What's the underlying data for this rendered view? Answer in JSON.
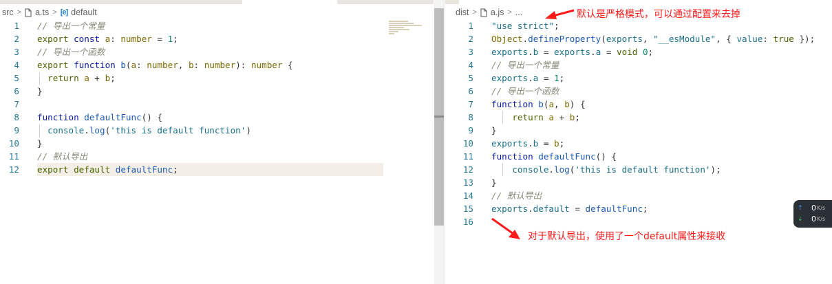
{
  "left": {
    "breadcrumb": {
      "folder": "src",
      "file": "a.ts",
      "symbol": "default"
    },
    "lines": [
      {
        "n": "1",
        "tokens": [
          {
            "t": "// 导出一个常量",
            "c": "c"
          }
        ]
      },
      {
        "n": "2",
        "tokens": [
          {
            "t": "export ",
            "c": "kw"
          },
          {
            "t": "const ",
            "c": "kw2"
          },
          {
            "t": "a",
            "c": "id"
          },
          {
            "t": ": ",
            "c": "pl"
          },
          {
            "t": "number",
            "c": "ty"
          },
          {
            "t": " = ",
            "c": "pl"
          },
          {
            "t": "1",
            "c": "num"
          },
          {
            "t": ";",
            "c": "pl"
          }
        ]
      },
      {
        "n": "3",
        "tokens": [
          {
            "t": "// 导出一个函数",
            "c": "c"
          }
        ]
      },
      {
        "n": "4",
        "tokens": [
          {
            "t": "export ",
            "c": "kw"
          },
          {
            "t": "function ",
            "c": "kw2"
          },
          {
            "t": "b",
            "c": "fn"
          },
          {
            "t": "(",
            "c": "pl"
          },
          {
            "t": "a",
            "c": "id"
          },
          {
            "t": ": ",
            "c": "pl"
          },
          {
            "t": "number",
            "c": "ty"
          },
          {
            "t": ", ",
            "c": "pl"
          },
          {
            "t": "b",
            "c": "id"
          },
          {
            "t": ": ",
            "c": "pl"
          },
          {
            "t": "number",
            "c": "ty"
          },
          {
            "t": "): ",
            "c": "pl"
          },
          {
            "t": "number",
            "c": "ty"
          },
          {
            "t": " {",
            "c": "pl"
          }
        ]
      },
      {
        "n": "5",
        "tokens": [
          {
            "t": "  return ",
            "c": "kw"
          },
          {
            "t": "a",
            "c": "id"
          },
          {
            "t": " + ",
            "c": "pl"
          },
          {
            "t": "b",
            "c": "id"
          },
          {
            "t": ";",
            "c": "pl"
          }
        ]
      },
      {
        "n": "6",
        "tokens": [
          {
            "t": "}",
            "c": "pl"
          }
        ]
      },
      {
        "n": "7",
        "tokens": []
      },
      {
        "n": "8",
        "tokens": [
          {
            "t": "function ",
            "c": "kw2"
          },
          {
            "t": "defaultFunc",
            "c": "fn"
          },
          {
            "t": "() {",
            "c": "pl"
          }
        ]
      },
      {
        "n": "9",
        "tokens": [
          {
            "t": "  console",
            "c": "str2"
          },
          {
            "t": ".",
            "c": "pl"
          },
          {
            "t": "log",
            "c": "fn"
          },
          {
            "t": "(",
            "c": "pl"
          },
          {
            "t": "'this is default function'",
            "c": "str2"
          },
          {
            "t": ")",
            "c": "pl"
          }
        ]
      },
      {
        "n": "10",
        "tokens": [
          {
            "t": "}",
            "c": "pl"
          }
        ]
      },
      {
        "n": "11",
        "tokens": [
          {
            "t": "// 默认导出",
            "c": "c"
          }
        ]
      },
      {
        "n": "12",
        "tokens": [
          {
            "t": "export ",
            "c": "kw"
          },
          {
            "t": "default ",
            "c": "kw"
          },
          {
            "t": "defaultFunc",
            "c": "fn"
          },
          {
            "t": ";",
            "c": "pl"
          }
        ]
      }
    ]
  },
  "right": {
    "breadcrumb": {
      "folder": "dist",
      "file": "a.js",
      "more": "..."
    },
    "lines": [
      {
        "n": "1",
        "tokens": [
          {
            "t": "\"use strict\"",
            "c": "str2"
          },
          {
            "t": ";",
            "c": "pl"
          }
        ]
      },
      {
        "n": "2",
        "tokens": [
          {
            "t": "Object",
            "c": "id"
          },
          {
            "t": ".",
            "c": "pl"
          },
          {
            "t": "defineProperty",
            "c": "fn"
          },
          {
            "t": "(",
            "c": "pl"
          },
          {
            "t": "exports",
            "c": "str2"
          },
          {
            "t": ", ",
            "c": "pl"
          },
          {
            "t": "\"__esModule\"",
            "c": "str2"
          },
          {
            "t": ", { ",
            "c": "pl"
          },
          {
            "t": "value",
            "c": "str2"
          },
          {
            "t": ": ",
            "c": "pl"
          },
          {
            "t": "true",
            "c": "kw"
          },
          {
            "t": " });",
            "c": "pl"
          }
        ]
      },
      {
        "n": "3",
        "tokens": [
          {
            "t": "exports",
            "c": "str2"
          },
          {
            "t": ".",
            "c": "pl"
          },
          {
            "t": "b",
            "c": "str2"
          },
          {
            "t": " = ",
            "c": "pl"
          },
          {
            "t": "exports",
            "c": "str2"
          },
          {
            "t": ".",
            "c": "pl"
          },
          {
            "t": "a",
            "c": "str2"
          },
          {
            "t": " = ",
            "c": "pl"
          },
          {
            "t": "void ",
            "c": "kw"
          },
          {
            "t": "0",
            "c": "num"
          },
          {
            "t": ";",
            "c": "pl"
          }
        ]
      },
      {
        "n": "4",
        "tokens": [
          {
            "t": "// 导出一个常量",
            "c": "c"
          }
        ]
      },
      {
        "n": "5",
        "tokens": [
          {
            "t": "exports",
            "c": "str2"
          },
          {
            "t": ".",
            "c": "pl"
          },
          {
            "t": "a",
            "c": "str2"
          },
          {
            "t": " = ",
            "c": "pl"
          },
          {
            "t": "1",
            "c": "num"
          },
          {
            "t": ";",
            "c": "pl"
          }
        ]
      },
      {
        "n": "6",
        "tokens": [
          {
            "t": "// 导出一个函数",
            "c": "c"
          }
        ]
      },
      {
        "n": "7",
        "tokens": [
          {
            "t": "function ",
            "c": "kw2"
          },
          {
            "t": "b",
            "c": "fn"
          },
          {
            "t": "(",
            "c": "pl"
          },
          {
            "t": "a",
            "c": "id"
          },
          {
            "t": ", ",
            "c": "pl"
          },
          {
            "t": "b",
            "c": "id"
          },
          {
            "t": ") {",
            "c": "pl"
          }
        ]
      },
      {
        "n": "8",
        "tokens": [
          {
            "t": "    return ",
            "c": "kw"
          },
          {
            "t": "a",
            "c": "id"
          },
          {
            "t": " + ",
            "c": "pl"
          },
          {
            "t": "b",
            "c": "id"
          },
          {
            "t": ";",
            "c": "pl"
          }
        ]
      },
      {
        "n": "9",
        "tokens": [
          {
            "t": "}",
            "c": "pl"
          }
        ]
      },
      {
        "n": "10",
        "tokens": [
          {
            "t": "exports",
            "c": "str2"
          },
          {
            "t": ".",
            "c": "pl"
          },
          {
            "t": "b",
            "c": "str2"
          },
          {
            "t": " = ",
            "c": "pl"
          },
          {
            "t": "b",
            "c": "id"
          },
          {
            "t": ";",
            "c": "pl"
          }
        ]
      },
      {
        "n": "11",
        "tokens": [
          {
            "t": "function ",
            "c": "kw2"
          },
          {
            "t": "defaultFunc",
            "c": "fn"
          },
          {
            "t": "() {",
            "c": "pl"
          }
        ]
      },
      {
        "n": "12",
        "tokens": [
          {
            "t": "    console",
            "c": "str2"
          },
          {
            "t": ".",
            "c": "pl"
          },
          {
            "t": "log",
            "c": "fn"
          },
          {
            "t": "(",
            "c": "pl"
          },
          {
            "t": "'this is default function'",
            "c": "str2"
          },
          {
            "t": ");",
            "c": "pl"
          }
        ]
      },
      {
        "n": "13",
        "tokens": [
          {
            "t": "}",
            "c": "pl"
          }
        ]
      },
      {
        "n": "14",
        "tokens": [
          {
            "t": "// 默认导出",
            "c": "c"
          }
        ]
      },
      {
        "n": "15",
        "tokens": [
          {
            "t": "exports",
            "c": "str2"
          },
          {
            "t": ".",
            "c": "pl"
          },
          {
            "t": "default",
            "c": "str2"
          },
          {
            "t": " = ",
            "c": "pl"
          },
          {
            "t": "defaultFunc",
            "c": "fn"
          },
          {
            "t": ";",
            "c": "pl"
          }
        ]
      },
      {
        "n": "16",
        "tokens": []
      }
    ]
  },
  "annotations": {
    "top": "默认是严格模式，可以通过配置来去掉",
    "bottom": "对于默认导出，使用了一个default属性来接收"
  },
  "net_widget": {
    "up_value": "0",
    "up_unit": "K/s",
    "down_value": "0",
    "down_unit": "K/s"
  },
  "colors": {
    "annotation": "#ff1a1a",
    "highlight_line": "#f4efe6"
  }
}
